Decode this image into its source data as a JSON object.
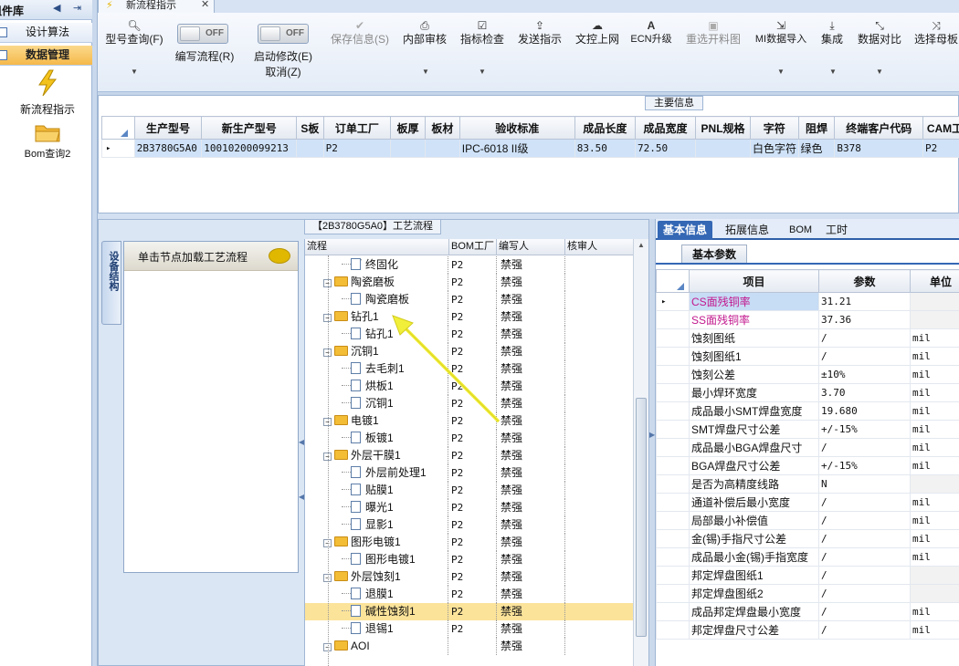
{
  "sidebar": {
    "header": "组件库",
    "items": [
      {
        "label": "设计算法"
      },
      {
        "label": "数据管理"
      }
    ],
    "launchers": [
      {
        "label": "新流程指示",
        "icon": "lightning-icon"
      },
      {
        "label": "Bom查询2",
        "icon": "folder-icon"
      }
    ]
  },
  "doc_tab": {
    "label": "新流程指示"
  },
  "toolbar": {
    "item_query": "型号查询(F)",
    "write_flow": "编写流程(R)",
    "write_flow_state": "OFF",
    "auto_modify": "启动修改(E)",
    "auto_modify_state": "OFF",
    "cancel": "取消(Z)",
    "save": "保存信息(S)",
    "internal_review": "内部审核",
    "indicator_check": "指标检查",
    "send": "发送指示",
    "doc_upload": "文控上网",
    "ecn": "ECN升级",
    "reselect": "重选开料图",
    "mi_import": "MI数据导入",
    "integrate": "集成",
    "compare": "数据对比",
    "select_master": "选择母板"
  },
  "main_info": {
    "label": "主要信息",
    "columns": [
      "生产型号",
      "新生产型号",
      "S板",
      "订单工厂",
      "板厚",
      "板材",
      "验收标准",
      "成品长度",
      "成品宽度",
      "PNL规格",
      "字符",
      "阻焊",
      "终端客户代码",
      "CAM工厂"
    ],
    "rows": [
      [
        "2B3780G5A0",
        "10010200099213",
        "",
        "P2",
        "",
        "",
        "IPC-6018 II级",
        "83.50",
        "72.50",
        "",
        "白色字符",
        "绿色",
        "B378",
        "P2"
      ]
    ]
  },
  "process": {
    "label": "【2B3780G5A0】工艺流程",
    "side_tab": "设备结构",
    "load_hint": "单击节点加载工艺流程",
    "columns": [
      "流程",
      "BOM工厂",
      "编写人",
      "核审人"
    ],
    "rows": [
      {
        "name": "终固化",
        "level": 2,
        "bom": "P2",
        "author": "禁强"
      },
      {
        "name": "陶瓷磨板",
        "level": 1,
        "bom": "P2",
        "author": "禁强"
      },
      {
        "name": "陶瓷磨板",
        "level": 2,
        "bom": "P2",
        "author": "禁强"
      },
      {
        "name": "钻孔1",
        "level": 1,
        "bom": "P2",
        "author": "禁强"
      },
      {
        "name": "钻孔1",
        "level": 2,
        "bom": "P2",
        "author": "禁强"
      },
      {
        "name": "沉铜1",
        "level": 1,
        "bom": "P2",
        "author": "禁强"
      },
      {
        "name": "去毛刺1",
        "level": 2,
        "bom": "P2",
        "author": "禁强"
      },
      {
        "name": "烘板1",
        "level": 2,
        "bom": "P2",
        "author": "禁强"
      },
      {
        "name": "沉铜1",
        "level": 2,
        "bom": "P2",
        "author": "禁强"
      },
      {
        "name": "电镀1",
        "level": 1,
        "bom": "P2",
        "author": "禁强"
      },
      {
        "name": "板镀1",
        "level": 2,
        "bom": "P2",
        "author": "禁强"
      },
      {
        "name": "外层干膜1",
        "level": 1,
        "bom": "P2",
        "author": "禁强"
      },
      {
        "name": "外层前处理1",
        "level": 2,
        "bom": "P2",
        "author": "禁强"
      },
      {
        "name": "贴膜1",
        "level": 2,
        "bom": "P2",
        "author": "禁强"
      },
      {
        "name": "曝光1",
        "level": 2,
        "bom": "P2",
        "author": "禁强"
      },
      {
        "name": "显影1",
        "level": 2,
        "bom": "P2",
        "author": "禁强"
      },
      {
        "name": "图形电镀1",
        "level": 1,
        "bom": "P2",
        "author": "禁强"
      },
      {
        "name": "图形电镀1",
        "level": 2,
        "bom": "P2",
        "author": "禁强"
      },
      {
        "name": "外层蚀刻1",
        "level": 1,
        "bom": "P2",
        "author": "禁强"
      },
      {
        "name": "退膜1",
        "level": 2,
        "bom": "P2",
        "author": "禁强"
      },
      {
        "name": "碱性蚀刻1",
        "level": 2,
        "bom": "P2",
        "author": "禁强",
        "selected": true
      },
      {
        "name": "退锡1",
        "level": 2,
        "bom": "P2",
        "author": "禁强"
      },
      {
        "name": "AOI",
        "level": 1,
        "bom": "",
        "author": "禁强"
      }
    ]
  },
  "details": {
    "tabs": [
      "基本信息",
      "拓展信息",
      "BOM",
      "工时"
    ],
    "subtab": "基本参数",
    "columns": [
      "项目",
      "参数",
      "单位"
    ],
    "rows": [
      {
        "item": "CS面残铜率",
        "value": "31.21",
        "unit": "",
        "pink": true
      },
      {
        "item": "SS面残铜率",
        "value": "37.36",
        "unit": "",
        "pink": true
      },
      {
        "item": "蚀刻图纸",
        "value": "/",
        "unit": "mil"
      },
      {
        "item": "蚀刻图纸1",
        "value": "/",
        "unit": "mil"
      },
      {
        "item": "蚀刻公差",
        "value": "±10%",
        "unit": "mil"
      },
      {
        "item": "最小焊环宽度",
        "value": "3.70",
        "unit": "mil"
      },
      {
        "item": "成品最小SMT焊盘宽度",
        "value": "19.680",
        "unit": "mil"
      },
      {
        "item": "SMT焊盘尺寸公差",
        "value": "+/-15%",
        "unit": "mil"
      },
      {
        "item": "成品最小BGA焊盘尺寸",
        "value": "/",
        "unit": "mil"
      },
      {
        "item": "BGA焊盘尺寸公差",
        "value": "+/-15%",
        "unit": "mil"
      },
      {
        "item": "是否为高精度线路",
        "value": "N",
        "unit": ""
      },
      {
        "item": "通道补偿后最小宽度",
        "value": "/",
        "unit": "mil"
      },
      {
        "item": "局部最小补偿值",
        "value": "/",
        "unit": "mil"
      },
      {
        "item": "金(锡)手指尺寸公差",
        "value": "/",
        "unit": "mil"
      },
      {
        "item": "成品最小金(锡)手指宽度",
        "value": "/",
        "unit": "mil"
      },
      {
        "item": "邦定焊盘图纸1",
        "value": "/",
        "unit": ""
      },
      {
        "item": "邦定焊盘图纸2",
        "value": "/",
        "unit": ""
      },
      {
        "item": "成品邦定焊盘最小宽度",
        "value": "/",
        "unit": "mil"
      },
      {
        "item": "邦定焊盘尺寸公差",
        "value": "/",
        "unit": "mil"
      }
    ]
  },
  "colors": {
    "accent": "#3467b4",
    "selected_row": "#fbe39a",
    "sidebar_active": "#f9c86a",
    "pink_text": "#c2188e",
    "annotation_arrow": "#f2ef3a"
  }
}
